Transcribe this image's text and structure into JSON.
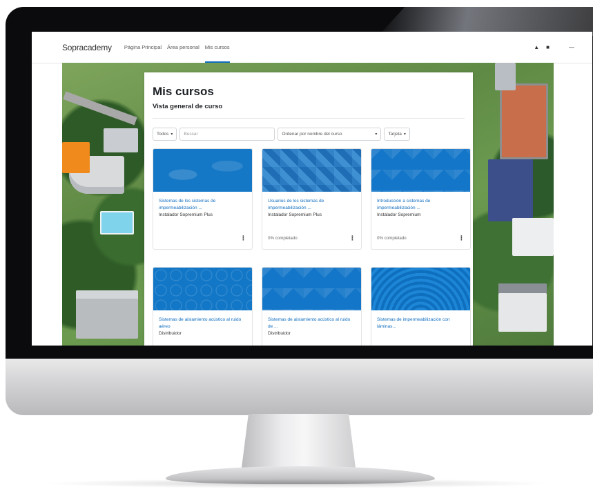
{
  "navbar": {
    "brand": "Sopracademy",
    "links": [
      "Página Principal",
      "Área personal",
      "Mis cursos"
    ],
    "icons": [
      "bell-icon",
      "chat-icon",
      "user-menu-icon"
    ]
  },
  "page": {
    "title": "Mis cursos",
    "section": "Vista general de curso"
  },
  "filters": {
    "grouping": "Todos",
    "search_placeholder": "Buscar",
    "sort": "Ordenar por nombre del curso",
    "view": "Tarjeta"
  },
  "courses": [
    {
      "title": "Sistemas de los sistemas de impermeabilización ...",
      "category": "Instalador Sopremium Plus",
      "progress": ""
    },
    {
      "title": "Usuarios de los sistemas de impermeabilización ...",
      "category": "Instalador Sopremium Plus",
      "progress": "0% completado"
    },
    {
      "title": "Introducción a sistemas de impermeabilización ...",
      "category": "Instalador Sopremium",
      "progress": "0% completado"
    },
    {
      "title": "Sistemas de aislamiento acústico al ruido aéreo",
      "category": "Distribuidor",
      "progress": ""
    },
    {
      "title": "Sistemas de aislamiento acústico al ruido de ...",
      "category": "Distribuidor",
      "progress": ""
    },
    {
      "title": "Sistemas de impermeabilización con láminas...",
      "category": "",
      "progress": ""
    }
  ],
  "colors": {
    "accent": "#0f6cbf",
    "card_blue": "#1376c9"
  }
}
